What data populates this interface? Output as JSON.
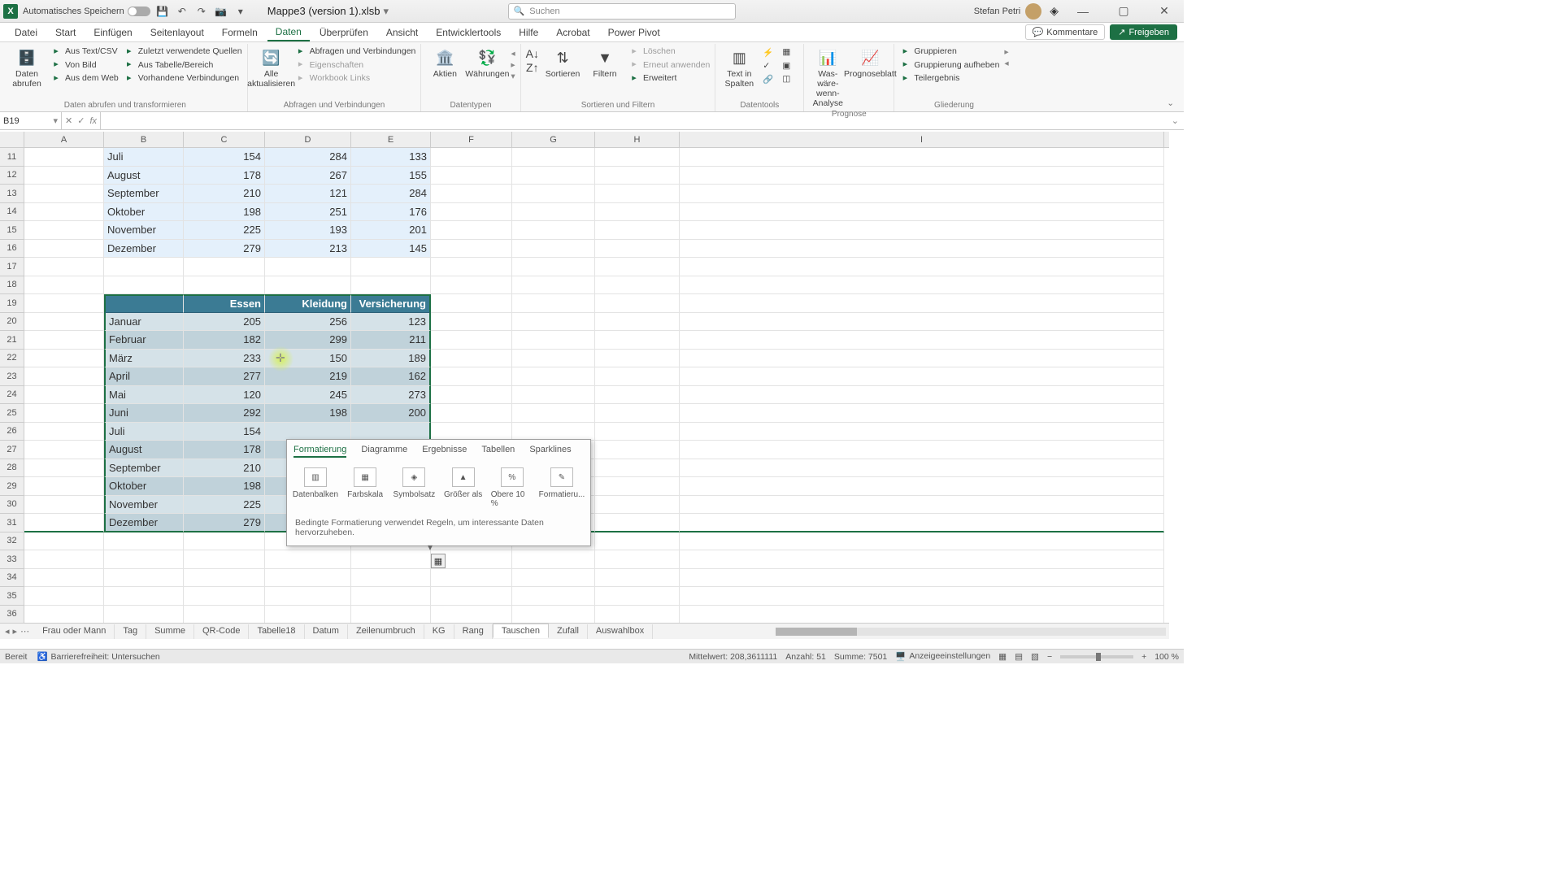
{
  "title_bar": {
    "autosave_label": "Automatisches Speichern",
    "file_name": "Mappe3 (version 1).xlsb",
    "search_placeholder": "Suchen",
    "user_name": "Stefan Petri"
  },
  "ribbon_tabs": [
    "Datei",
    "Start",
    "Einfügen",
    "Seitenlayout",
    "Formeln",
    "Daten",
    "Überprüfen",
    "Ansicht",
    "Entwicklertools",
    "Hilfe",
    "Acrobat",
    "Power Pivot"
  ],
  "ribbon_tabs_active": 5,
  "ribbon_right": {
    "comments": "Kommentare",
    "share": "Freigeben"
  },
  "ribbon": {
    "g1": {
      "big": "Daten abrufen",
      "items": [
        "Aus Text/CSV",
        "Von Bild",
        "Aus dem Web",
        "Zuletzt verwendete Quellen",
        "Aus Tabelle/Bereich",
        "Vorhandene Verbindungen"
      ],
      "label": "Daten abrufen und transformieren"
    },
    "g2": {
      "big": "Alle aktualisieren",
      "items": [
        "Abfragen und Verbindungen",
        "Eigenschaften",
        "Workbook Links"
      ],
      "items_disabled": [
        1,
        2
      ],
      "label": "Abfragen und Verbindungen"
    },
    "g3": {
      "btn1": "Aktien",
      "btn2": "Währungen",
      "label": "Datentypen"
    },
    "g4": {
      "btn1": "Sortieren",
      "btn2": "Filtern",
      "items": [
        "Löschen",
        "Erneut anwenden",
        "Erweitert"
      ],
      "items_disabled": [
        0,
        1
      ],
      "label": "Sortieren und Filtern"
    },
    "g5": {
      "btn": "Text in Spalten",
      "label": "Datentools"
    },
    "g6": {
      "btn1": "Was-wäre-wenn-Analyse",
      "btn2": "Prognoseblatt",
      "label": "Prognose"
    },
    "g7": {
      "items": [
        "Gruppieren",
        "Gruppierung aufheben",
        "Teilergebnis"
      ],
      "label": "Gliederung"
    }
  },
  "name_box": "B19",
  "col_headers": [
    "A",
    "B",
    "C",
    "D",
    "E",
    "F",
    "G",
    "H",
    "I"
  ],
  "rows_top": [
    {
      "n": 11,
      "b": "Juli",
      "c": "154",
      "d": "284",
      "e": "133"
    },
    {
      "n": 12,
      "b": "August",
      "c": "178",
      "d": "267",
      "e": "155"
    },
    {
      "n": 13,
      "b": "September",
      "c": "210",
      "d": "121",
      "e": "284"
    },
    {
      "n": 14,
      "b": "Oktober",
      "c": "198",
      "d": "251",
      "e": "176"
    },
    {
      "n": 15,
      "b": "November",
      "c": "225",
      "d": "193",
      "e": "201"
    },
    {
      "n": 16,
      "b": "Dezember",
      "c": "279",
      "d": "213",
      "e": "145"
    }
  ],
  "tbl_head": {
    "b": "",
    "c": "Essen",
    "d": "Kleidung",
    "e": "Versicherung"
  },
  "rows_tbl": [
    {
      "n": 20,
      "b": "Januar",
      "c": "205",
      "d": "256",
      "e": "123"
    },
    {
      "n": 21,
      "b": "Februar",
      "c": "182",
      "d": "299",
      "e": "211"
    },
    {
      "n": 22,
      "b": "März",
      "c": "233",
      "d": "150",
      "e": "189"
    },
    {
      "n": 23,
      "b": "April",
      "c": "277",
      "d": "219",
      "e": "162"
    },
    {
      "n": 24,
      "b": "Mai",
      "c": "120",
      "d": "245",
      "e": "273"
    },
    {
      "n": 25,
      "b": "Juni",
      "c": "292",
      "d": "198",
      "e": "200"
    },
    {
      "n": 26,
      "b": "Juli",
      "c": "154",
      "d": "",
      "e": ""
    },
    {
      "n": 27,
      "b": "August",
      "c": "178",
      "d": "",
      "e": ""
    },
    {
      "n": 28,
      "b": "September",
      "c": "210",
      "d": "",
      "e": ""
    },
    {
      "n": 29,
      "b": "Oktober",
      "c": "198",
      "d": "",
      "e": ""
    },
    {
      "n": 30,
      "b": "November",
      "c": "225",
      "d": "",
      "e": ""
    },
    {
      "n": 31,
      "b": "Dezember",
      "c": "279",
      "d": "",
      "e": ""
    }
  ],
  "empty_rows": [
    17,
    18,
    32,
    33,
    34,
    35,
    36
  ],
  "qa": {
    "tabs": [
      "Formatierung",
      "Diagramme",
      "Ergebnisse",
      "Tabellen",
      "Sparklines"
    ],
    "tabs_active": 0,
    "options": [
      "Datenbalken",
      "Farbskala",
      "Symbolsatz",
      "Größer als",
      "Obere 10 %",
      "Formatieru..."
    ],
    "desc": "Bedingte Formatierung verwendet Regeln, um interessante Daten hervorzuheben."
  },
  "sheet_tabs": [
    "Frau oder Mann",
    "Tag",
    "Summe",
    "QR-Code",
    "Tabelle18",
    "Datum",
    "Zeilenumbruch",
    "KG",
    "Rang",
    "Tauschen",
    "Zufall",
    "Auswahlbox"
  ],
  "sheet_tabs_active": 9,
  "status": {
    "ready": "Bereit",
    "access": "Barrierefreiheit: Untersuchen",
    "avg": "Mittelwert: 208,3611111",
    "count": "Anzahl: 51",
    "sum": "Summe: 7501",
    "display": "Anzeigeeinstellungen",
    "zoom": "100 %"
  }
}
